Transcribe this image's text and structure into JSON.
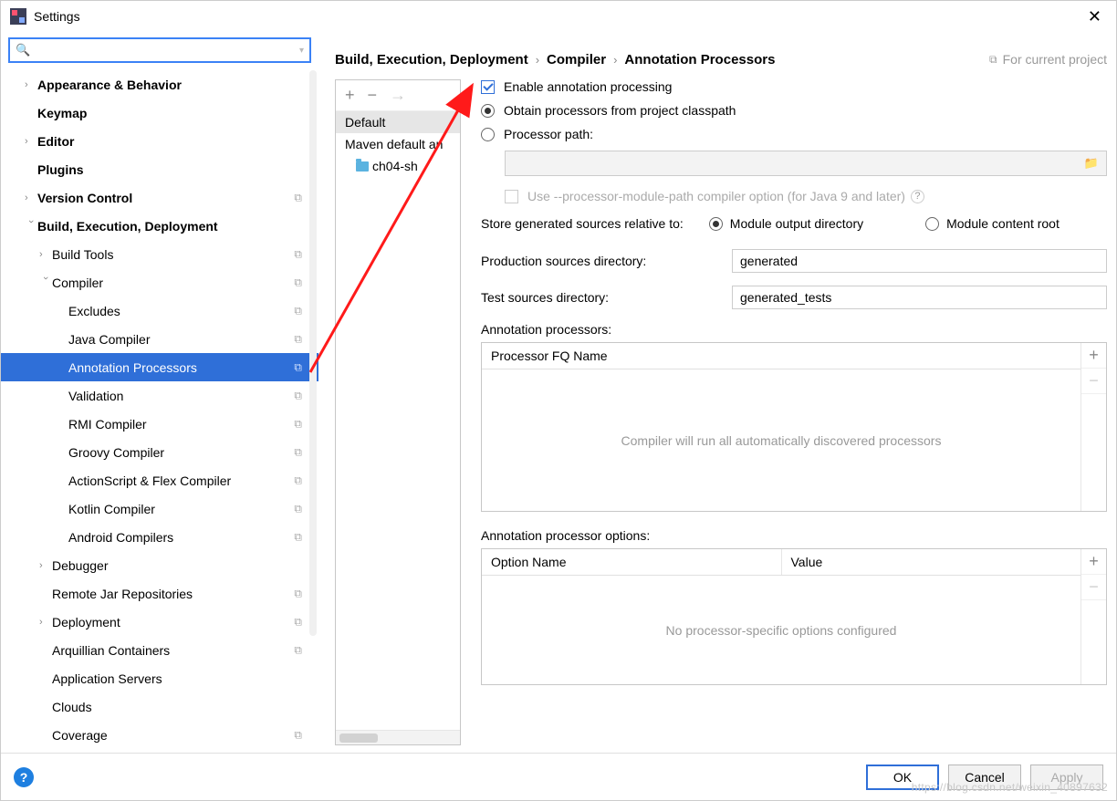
{
  "window": {
    "title": "Settings"
  },
  "search": {
    "placeholder": ""
  },
  "nav": {
    "appearance": "Appearance & Behavior",
    "keymap": "Keymap",
    "editor": "Editor",
    "plugins": "Plugins",
    "vcs": "Version Control",
    "bed": "Build, Execution, Deployment",
    "build_tools": "Build Tools",
    "compiler": "Compiler",
    "excludes": "Excludes",
    "java_compiler": "Java Compiler",
    "annotation_processors": "Annotation Processors",
    "validation": "Validation",
    "rmi": "RMI Compiler",
    "groovy": "Groovy Compiler",
    "asflex": "ActionScript & Flex Compiler",
    "kotlin": "Kotlin Compiler",
    "android": "Android Compilers",
    "debugger": "Debugger",
    "remote_jar": "Remote Jar Repositories",
    "deployment": "Deployment",
    "arquillian": "Arquillian Containers",
    "appservers": "Application Servers",
    "clouds": "Clouds",
    "coverage": "Coverage"
  },
  "breadcrumb": {
    "a": "Build, Execution, Deployment",
    "b": "Compiler",
    "c": "Annotation Processors",
    "forproj": "For current project"
  },
  "profiles": {
    "default": "Default",
    "maven": "Maven default an",
    "child": "ch04-sh"
  },
  "form": {
    "enable": "Enable annotation processing",
    "obtain": "Obtain processors from project classpath",
    "procpath": "Processor path:",
    "modulepath": "Use --processor-module-path compiler option (for Java 9 and later)",
    "store_label": "Store generated sources relative to:",
    "store_module_output": "Module output directory",
    "store_module_content": "Module content root",
    "prod_dir_label": "Production sources directory:",
    "prod_dir_value": "generated",
    "test_dir_label": "Test sources directory:",
    "test_dir_value": "generated_tests",
    "ann_proc_label": "Annotation processors:",
    "proc_fq_header": "Processor FQ Name",
    "proc_empty": "Compiler will run all automatically discovered processors",
    "opt_label": "Annotation processor options:",
    "opt_name": "Option Name",
    "opt_value": "Value",
    "opt_empty": "No processor-specific options configured"
  },
  "buttons": {
    "ok": "OK",
    "cancel": "Cancel",
    "apply": "Apply"
  },
  "watermark": "https://blog.csdn.net/weixin_40897632"
}
